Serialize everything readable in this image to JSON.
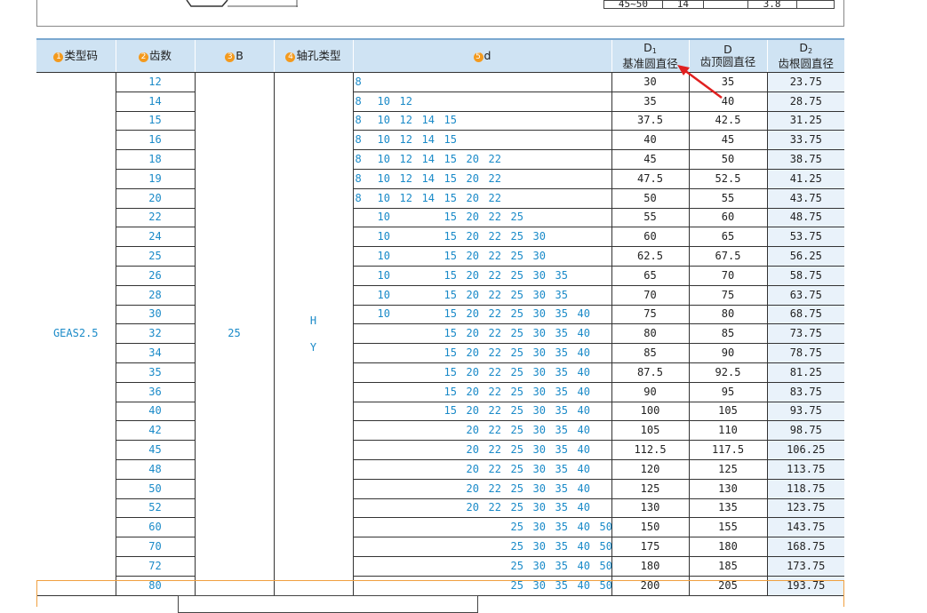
{
  "top_remnant": {
    "mini_table": [
      "45~50",
      "14",
      "",
      "3.8",
      ""
    ]
  },
  "header": {
    "col1_num": "1",
    "col1_label": "类型码",
    "col2_num": "2",
    "col2_label": "齿数",
    "col3_num": "3",
    "col3_label": "B",
    "col4_num": "4",
    "col4_label": "轴孔类型",
    "col5_num": "5",
    "col5_label": "d",
    "col6_symbol": "D",
    "col6_sub": "1",
    "col6_label": "基准圆直径",
    "col7_symbol": "D",
    "col7_label": "齿顶圆直径",
    "col8_symbol": "D",
    "col8_sub": "2",
    "col8_label": "齿根圆直径"
  },
  "merged": {
    "type_code": "GEAS2.5",
    "b": "25",
    "shaft_types": [
      "H",
      "Y"
    ]
  },
  "d_columns": [
    "8",
    "10",
    "12",
    "14",
    "15",
    "20",
    "22",
    "25",
    "30",
    "35",
    "40",
    "50"
  ],
  "rows": [
    {
      "teeth": "12",
      "d": [
        "8"
      ],
      "d1": "30",
      "da": "35",
      "df": "23.75"
    },
    {
      "teeth": "14",
      "d": [
        "8",
        "10",
        "12"
      ],
      "d1": "35",
      "da": "40",
      "df": "28.75"
    },
    {
      "teeth": "15",
      "d": [
        "8",
        "10",
        "12",
        "14",
        "15"
      ],
      "d1": "37.5",
      "da": "42.5",
      "df": "31.25"
    },
    {
      "teeth": "16",
      "d": [
        "8",
        "10",
        "12",
        "14",
        "15"
      ],
      "d1": "40",
      "da": "45",
      "df": "33.75"
    },
    {
      "teeth": "18",
      "d": [
        "8",
        "10",
        "12",
        "14",
        "15",
        "20",
        "22"
      ],
      "d1": "45",
      "da": "50",
      "df": "38.75"
    },
    {
      "teeth": "19",
      "d": [
        "8",
        "10",
        "12",
        "14",
        "15",
        "20",
        "22"
      ],
      "d1": "47.5",
      "da": "52.5",
      "df": "41.25"
    },
    {
      "teeth": "20",
      "d": [
        "8",
        "10",
        "12",
        "14",
        "15",
        "20",
        "22"
      ],
      "d1": "50",
      "da": "55",
      "df": "43.75"
    },
    {
      "teeth": "22",
      "d": [
        "10",
        "15",
        "20",
        "22",
        "25"
      ],
      "d1": "55",
      "da": "60",
      "df": "48.75"
    },
    {
      "teeth": "24",
      "d": [
        "10",
        "15",
        "20",
        "22",
        "25",
        "30"
      ],
      "d1": "60",
      "da": "65",
      "df": "53.75"
    },
    {
      "teeth": "25",
      "d": [
        "10",
        "15",
        "20",
        "22",
        "25",
        "30"
      ],
      "d1": "62.5",
      "da": "67.5",
      "df": "56.25"
    },
    {
      "teeth": "26",
      "d": [
        "10",
        "15",
        "20",
        "22",
        "25",
        "30",
        "35"
      ],
      "d1": "65",
      "da": "70",
      "df": "58.75"
    },
    {
      "teeth": "28",
      "d": [
        "10",
        "15",
        "20",
        "22",
        "25",
        "30",
        "35"
      ],
      "d1": "70",
      "da": "75",
      "df": "63.75"
    },
    {
      "teeth": "30",
      "d": [
        "10",
        "15",
        "20",
        "22",
        "25",
        "30",
        "35",
        "40"
      ],
      "d1": "75",
      "da": "80",
      "df": "68.75"
    },
    {
      "teeth": "32",
      "d": [
        "15",
        "20",
        "22",
        "25",
        "30",
        "35",
        "40"
      ],
      "d1": "80",
      "da": "85",
      "df": "73.75"
    },
    {
      "teeth": "34",
      "d": [
        "15",
        "20",
        "22",
        "25",
        "30",
        "35",
        "40"
      ],
      "d1": "85",
      "da": "90",
      "df": "78.75"
    },
    {
      "teeth": "35",
      "d": [
        "15",
        "20",
        "22",
        "25",
        "30",
        "35",
        "40"
      ],
      "d1": "87.5",
      "da": "92.5",
      "df": "81.25"
    },
    {
      "teeth": "36",
      "d": [
        "15",
        "20",
        "22",
        "25",
        "30",
        "35",
        "40"
      ],
      "d1": "90",
      "da": "95",
      "df": "83.75"
    },
    {
      "teeth": "40",
      "d": [
        "15",
        "20",
        "22",
        "25",
        "30",
        "35",
        "40"
      ],
      "d1": "100",
      "da": "105",
      "df": "93.75"
    },
    {
      "teeth": "42",
      "d": [
        "20",
        "22",
        "25",
        "30",
        "35",
        "40"
      ],
      "d1": "105",
      "da": "110",
      "df": "98.75"
    },
    {
      "teeth": "45",
      "d": [
        "20",
        "22",
        "25",
        "30",
        "35",
        "40"
      ],
      "d1": "112.5",
      "da": "117.5",
      "df": "106.25"
    },
    {
      "teeth": "48",
      "d": [
        "20",
        "22",
        "25",
        "30",
        "35",
        "40"
      ],
      "d1": "120",
      "da": "125",
      "df": "113.75"
    },
    {
      "teeth": "50",
      "d": [
        "20",
        "22",
        "25",
        "30",
        "35",
        "40"
      ],
      "d1": "125",
      "da": "130",
      "df": "118.75"
    },
    {
      "teeth": "52",
      "d": [
        "20",
        "22",
        "25",
        "30",
        "35",
        "40"
      ],
      "d1": "130",
      "da": "135",
      "df": "123.75"
    },
    {
      "teeth": "60",
      "d": [
        "25",
        "30",
        "35",
        "40",
        "50"
      ],
      "d1": "150",
      "da": "155",
      "df": "143.75"
    },
    {
      "teeth": "70",
      "d": [
        "25",
        "30",
        "35",
        "40",
        "50"
      ],
      "d1": "175",
      "da": "180",
      "df": "168.75"
    },
    {
      "teeth": "72",
      "d": [
        "25",
        "30",
        "35",
        "40",
        "50"
      ],
      "d1": "180",
      "da": "185",
      "df": "173.75"
    },
    {
      "teeth": "80",
      "d": [
        "25",
        "30",
        "35",
        "40",
        "50"
      ],
      "d1": "200",
      "da": "205",
      "df": "193.75"
    }
  ],
  "colors": {
    "header_bg": "#cfe3f3",
    "accent_blue": "#1a8ac8",
    "badge_orange": "#f39a1e",
    "arrow_red": "#e02020"
  }
}
